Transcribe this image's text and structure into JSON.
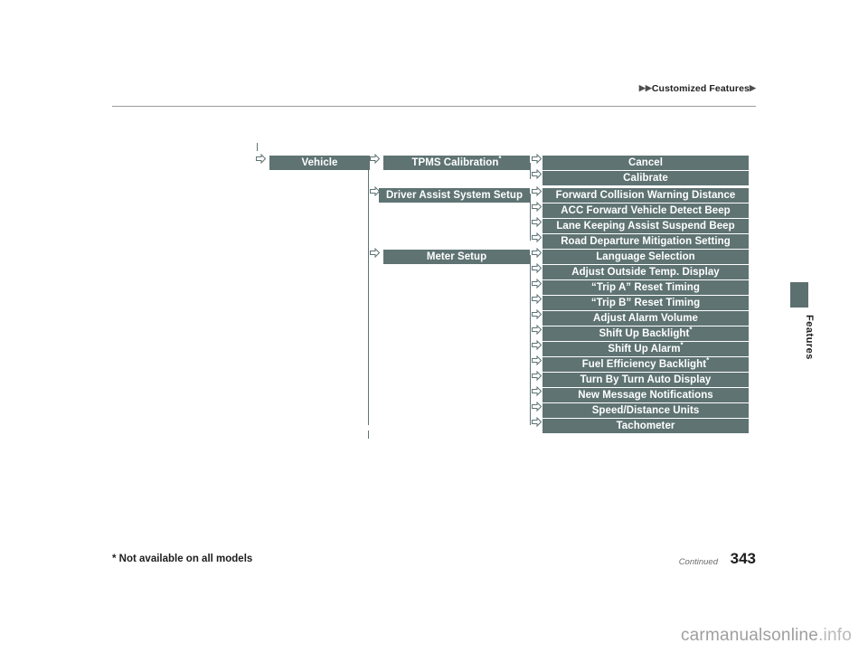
{
  "header": {
    "breadcrumb_prefix_arrows": "▶▶",
    "breadcrumb": "Customized Features",
    "breadcrumb_suffix_arrow": "▶"
  },
  "side_tab": {
    "label": "Features"
  },
  "footer": {
    "footnote": "* Not available on all models",
    "continued": "Continued",
    "page_number": "343"
  },
  "watermark": {
    "text": "carmanualsonline",
    "suffix": ".info"
  },
  "chart_data": {
    "type": "diagram",
    "title": "Customized Features menu tree",
    "columns": [
      {
        "level": 1,
        "items": [
          {
            "label": "Vehicle",
            "note": ""
          }
        ]
      },
      {
        "level": 2,
        "items": [
          {
            "label": "TPMS Calibration",
            "note": "*"
          },
          {
            "label": "Driver Assist System Setup",
            "note": ""
          },
          {
            "label": "Meter Setup",
            "note": ""
          }
        ]
      },
      {
        "level": 3,
        "groups": [
          {
            "parent": "TPMS Calibration",
            "items": [
              {
                "label": "Cancel",
                "note": ""
              },
              {
                "label": "Calibrate",
                "note": ""
              }
            ]
          },
          {
            "parent": "Driver Assist System Setup",
            "items": [
              {
                "label": "Forward Collision Warning Distance",
                "note": ""
              },
              {
                "label": "ACC Forward Vehicle Detect Beep",
                "note": ""
              },
              {
                "label": "Lane Keeping Assist Suspend Beep",
                "note": ""
              },
              {
                "label": "Road Departure Mitigation Setting",
                "note": ""
              }
            ]
          },
          {
            "parent": "Meter Setup",
            "items": [
              {
                "label": "Language Selection",
                "note": ""
              },
              {
                "label": "Adjust Outside Temp. Display",
                "note": ""
              },
              {
                "label": "“Trip A” Reset Timing",
                "note": ""
              },
              {
                "label": "“Trip B” Reset Timing",
                "note": ""
              },
              {
                "label": "Adjust Alarm Volume",
                "note": ""
              },
              {
                "label": "Shift Up Backlight",
                "note": "*"
              },
              {
                "label": "Shift Up Alarm",
                "note": "*"
              },
              {
                "label": "Fuel Efficiency Backlight",
                "note": "*"
              },
              {
                "label": "Turn By Turn Auto Display",
                "note": ""
              },
              {
                "label": "New Message Notifications",
                "note": ""
              },
              {
                "label": "Speed/Distance Units",
                "note": ""
              },
              {
                "label": "Tachometer",
                "note": ""
              }
            ]
          }
        ]
      }
    ],
    "colors": {
      "node_fill": "#5f7373",
      "node_text": "#ffffff",
      "connector": "#5f7373"
    }
  }
}
